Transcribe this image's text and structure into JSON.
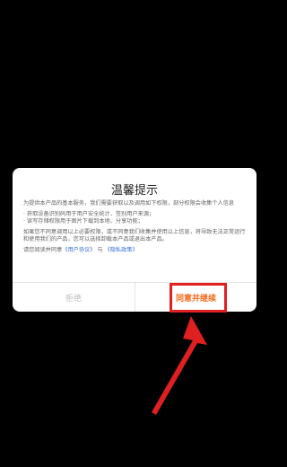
{
  "dialog": {
    "title": "温馨提示",
    "intro": "为提供本产品的基本服务，我们需要获取以及调用如下权限，部分权限会收集个人信息",
    "permissions": [
      "· 获取设备识别码用于用户安全统计、签别用户来源；",
      "· 读写存储权限用于图片下载到本地、分享功能；"
    ],
    "notice": "如果您不同意调用以上必要权限，或不同意我们收集并使用以上信息，将导致无法正常运行和使用我们的产品，您可以选择卸载本产品或退出本产品。",
    "agree_prefix": "请您阅读并同意",
    "user_agreement": "《用户协议》",
    "joiner": "与",
    "privacy_policy": "《隐私政策》",
    "reject_label": "拒绝",
    "accept_label": "同意并继续"
  },
  "colors": {
    "accept": "#f26a1b",
    "link": "#3a6fd8",
    "annotation": "#e02020"
  }
}
